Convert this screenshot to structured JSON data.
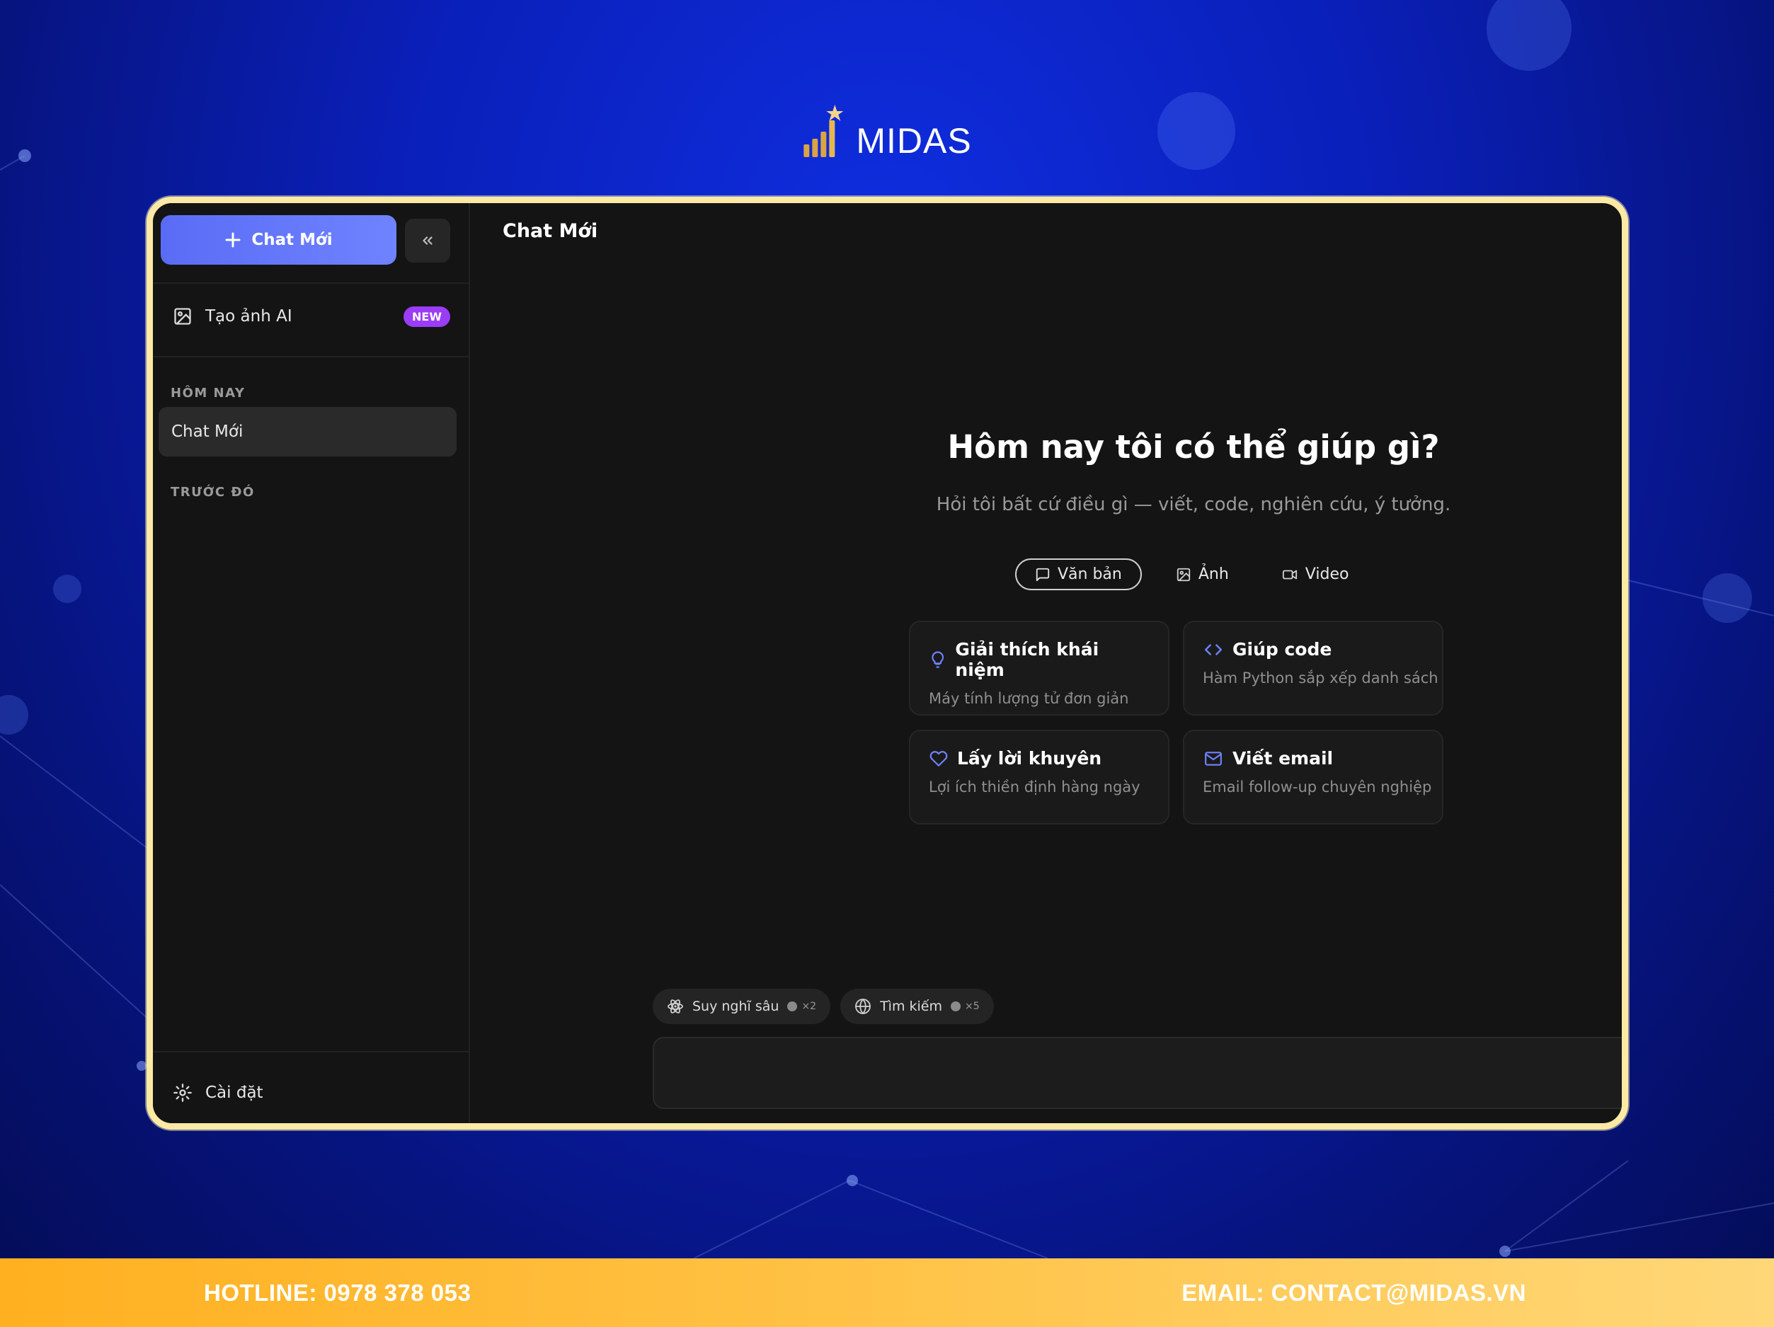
{
  "brand": {
    "name": "MIDAS"
  },
  "sidebar": {
    "new_chat_label": "Chat Mới",
    "ai_image_label": "Tạo ảnh AI",
    "new_badge": "NEW",
    "section_today": "HÔM NAY",
    "section_previous": "TRƯỚC ĐÓ",
    "chat_items": [
      {
        "label": "Chat Mới"
      }
    ],
    "settings_label": "Cài đặt"
  },
  "main": {
    "title": "Chat Mới",
    "hero_title": "Hôm nay tôi có thể giúp gì?",
    "hero_subtitle": "Hỏi tôi bất cứ điều gì — viết, code, nghiên cứu, ý tưởng.",
    "modes": [
      {
        "label": "Văn bản",
        "icon": "message-square-icon",
        "active": true
      },
      {
        "label": "Ảnh",
        "icon": "image-icon",
        "active": false
      },
      {
        "label": "Video",
        "icon": "video-icon",
        "active": false
      }
    ],
    "suggestions": [
      {
        "title": "Giải thích khái niệm",
        "subtitle": "Máy tính lượng tử đơn giản",
        "icon": "lightbulb-icon"
      },
      {
        "title": "Giúp code",
        "subtitle": "Hàm Python sắp xếp danh sách",
        "icon": "code-icon"
      },
      {
        "title": "Lấy lời khuyên",
        "subtitle": "Lợi ích thiền định hàng ngày",
        "icon": "heart-icon"
      },
      {
        "title": "Viết email",
        "subtitle": "Email follow-up chuyên nghiệp",
        "icon": "mail-icon"
      }
    ],
    "chips": [
      {
        "label": "Suy nghĩ sâu",
        "multiplier": "×2",
        "icon": "atom-icon"
      },
      {
        "label": "Tìm kiếm",
        "multiplier": "×5",
        "icon": "globe-icon"
      }
    ],
    "input_placeholder": ""
  },
  "footer": {
    "hotline": "HOTLINE: 0978 378 053",
    "email": "EMAIL: CONTACT@MIDAS.VN"
  },
  "colors": {
    "accent": "#6f83ff",
    "badge": "#9b3cf6",
    "frame_border": "#fbeaa4",
    "footer": "#ffc347",
    "background": "#0a1fb8"
  }
}
